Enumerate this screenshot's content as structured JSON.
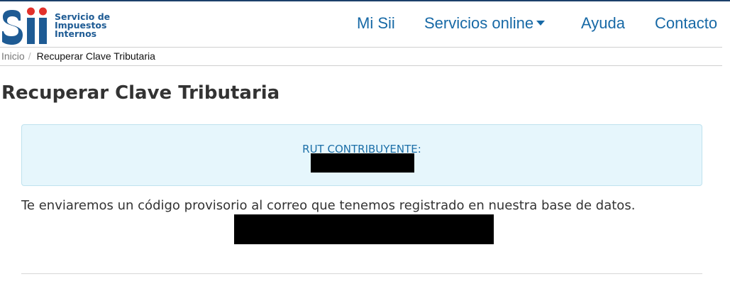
{
  "header": {
    "logo": {
      "lines": [
        "Servicio de",
        "Impuestos",
        "Internos"
      ]
    },
    "nav": [
      {
        "label": "Mi Sii"
      },
      {
        "label": "Servicios online",
        "has_dropdown": true
      },
      {
        "label": "Ayuda"
      },
      {
        "label": "Contacto"
      }
    ]
  },
  "breadcrumb": {
    "home": "Inicio",
    "separator": "/",
    "current": "Recuperar Clave Tributaria"
  },
  "page_title": "Recuperar Clave Tributaria",
  "info_box": {
    "rut_label": "RUT CONTRIBUYENTE:"
  },
  "message": "Te enviaremos un código provisorio al correo que tenemos registrado en nuestra base de datos.",
  "colors": {
    "brand_blue": "#1769a6",
    "logo_red": "#e2312b",
    "info_bg": "#e6f6fc"
  }
}
